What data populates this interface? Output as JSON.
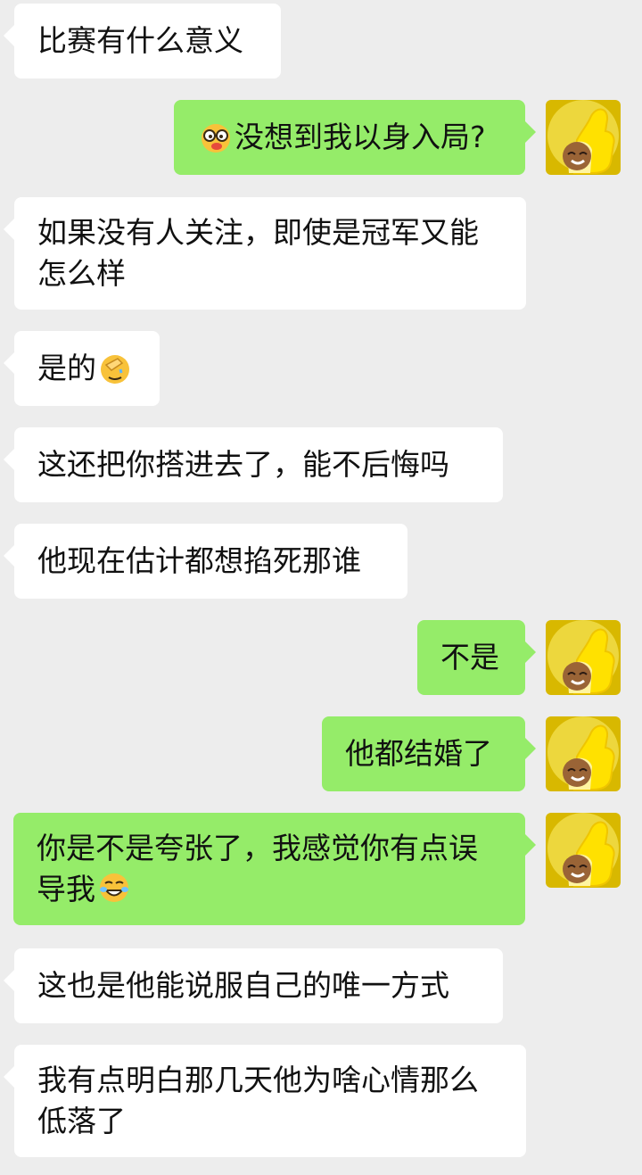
{
  "messages": [
    {
      "side": "in",
      "text": "比赛有什么意义"
    },
    {
      "side": "out",
      "text": "没想到我以身入局?",
      "emoji_before": "glasses-face-emoji"
    },
    {
      "side": "in",
      "lines": [
        "如果没有人关注，即使是冠军又能",
        "怎么样"
      ]
    },
    {
      "side": "in",
      "text": "是的",
      "emoji_after": "facepalm-emoji"
    },
    {
      "side": "in",
      "text": "这还把你搭进去了，能不后悔吗"
    },
    {
      "side": "in",
      "text": "他现在估计都想掐死那谁"
    },
    {
      "side": "out",
      "text": "不是"
    },
    {
      "side": "out",
      "text": "他都结婚了"
    },
    {
      "side": "out",
      "lines": [
        "你是不是夸张了，我感觉你有点误",
        "导我"
      ],
      "emoji_after": "tears-of-joy-emoji"
    },
    {
      "side": "in",
      "text": "这也是他能说服自己的唯一方式"
    },
    {
      "side": "in",
      "lines": [
        "我有点明白那几天他为啥心情那么",
        "低落了"
      ]
    }
  ],
  "colors": {
    "background": "#ededed",
    "incoming_bubble": "#ffffff",
    "outgoing_bubble": "#95ec69",
    "avatar_yellow": "#ffe100"
  },
  "avatar_icon": "yellow-thumbs-up-avatar"
}
